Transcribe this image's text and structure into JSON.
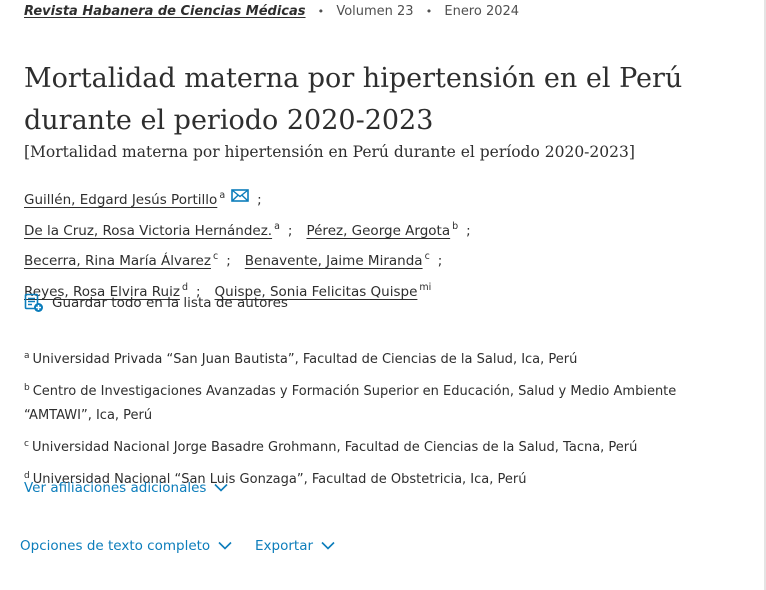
{
  "header": {
    "journal": "Revista Habanera de Ciencias Médicas",
    "volume": "Volumen 23",
    "date": "Enero 2024",
    "separator": "•"
  },
  "article": {
    "title_line1": "Mortalidad materna por hipertensión en el Perú",
    "title_line2": "durante el periodo 2020-2023",
    "subtitle": "[Mortalidad materna por hipertensión en Perú durante el período 2020-2023]"
  },
  "authors": [
    {
      "name": "Guillén, Edgard Jesús Portillo",
      "sup": "a"
    },
    {
      "name": "De la Cruz, Rosa Victoria Hernández.",
      "sup": "a"
    },
    {
      "name": "Pérez, George Argota",
      "sup": "b"
    },
    {
      "name": "Becerra, Rina María Álvarez",
      "sup": "c"
    },
    {
      "name": "Benavente, Jaime Miranda",
      "sup": "c"
    },
    {
      "name": "Reyes, Rosa Elvira Ruiz",
      "sup": "d"
    },
    {
      "name": "Quispe, Sonia Felicitas Quispe",
      "sup": "mi"
    }
  ],
  "author_separator": ";",
  "save_authors_label": "Guardar todo en la lista de autores",
  "affiliations": [
    {
      "sup": "a",
      "text": "Universidad Privada “San Juan Bautista”, Facultad de Ciencias de la Salud, Ica, Perú"
    },
    {
      "sup": "b",
      "text": "Centro de Investigaciones Avanzadas y Formación Superior en Educación, Salud y Medio Ambiente “AMTAWI”, Ica, Perú"
    },
    {
      "sup": "c",
      "text": "Universidad Nacional Jorge Basadre Grohmann, Facultad de Ciencias de la Salud, Tacna, Perú"
    },
    {
      "sup": "d",
      "text": "Universidad Nacional “San Luis Gonzaga”, Facultad de Obstetricia, Ica, Perú"
    }
  ],
  "more_affiliations_label": "Ver afiliaciones adicionales",
  "actions": {
    "fulltext_options": "Opciones de texto completo",
    "export": "Exportar"
  },
  "colors": {
    "link_blue": "#0c7dbb",
    "text": "#2e2e2e"
  },
  "icons": [
    "mail-icon",
    "save-list-icon",
    "chevron-down-icon"
  ]
}
